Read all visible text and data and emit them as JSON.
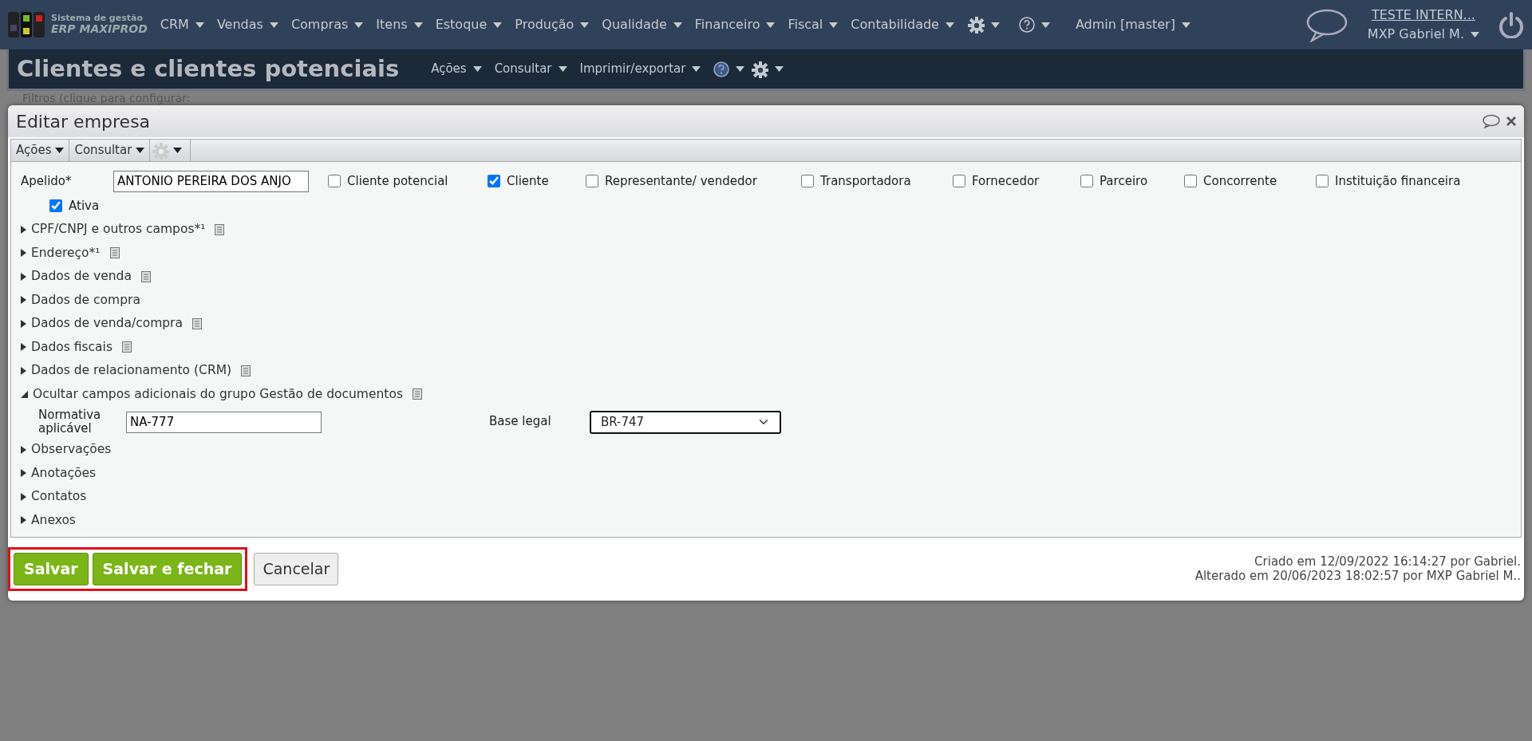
{
  "top_nav": {
    "logo": {
      "line1": "Sistema de gestão",
      "line2": "ERP MAXIPROD"
    },
    "menus": [
      {
        "label": "CRM"
      },
      {
        "label": "Vendas"
      },
      {
        "label": "Compras"
      },
      {
        "label": "Itens"
      },
      {
        "label": "Estoque"
      },
      {
        "label": "Produção"
      },
      {
        "label": "Qualidade"
      },
      {
        "label": "Financeiro"
      },
      {
        "label": "Fiscal"
      },
      {
        "label": "Contabilidade"
      }
    ],
    "admin": "Admin [master]",
    "company": "TESTE INTERN...",
    "user": "MXP Gabriel M."
  },
  "page_header": {
    "title": "Clientes e clientes potenciais",
    "menus": [
      "Ações",
      "Consultar",
      "Imprimir/exportar"
    ]
  },
  "filter_bar": {
    "text": "Filtros (clique para configurar:"
  },
  "dialog": {
    "title": "Editar empresa",
    "toolbar": [
      "Ações",
      "Consultar"
    ],
    "apelido": {
      "label": "Apelido*",
      "value": "ANTONIO PEREIRA DOS ANJO"
    },
    "roles": [
      {
        "label": "Cliente potencial",
        "checked": false
      },
      {
        "label": "Cliente",
        "checked": true
      },
      {
        "label": "Representante/ vendedor",
        "checked": false
      },
      {
        "label": "Transportadora",
        "checked": false
      },
      {
        "label": "Fornecedor",
        "checked": false
      },
      {
        "label": "Parceiro",
        "checked": false
      },
      {
        "label": "Concorrente",
        "checked": false
      },
      {
        "label": "Instituição financeira",
        "checked": false
      }
    ],
    "ativa": {
      "label": "Ativa",
      "checked": true
    },
    "sections": [
      {
        "label": "CPF/CNPJ e outros campos*¹",
        "expanded": false,
        "note": true
      },
      {
        "label": "Endereço*¹",
        "expanded": false,
        "note": true
      },
      {
        "label": "Dados de venda",
        "expanded": false,
        "note": true
      },
      {
        "label": "Dados de compra",
        "expanded": false,
        "note": false
      },
      {
        "label": "Dados de venda/compra",
        "expanded": false,
        "note": true
      },
      {
        "label": "Dados fiscais",
        "expanded": false,
        "note": true
      },
      {
        "label": "Dados de relacionamento (CRM)",
        "expanded": false,
        "note": true
      },
      {
        "label": "Ocultar campos adicionais do grupo Gestão de documentos",
        "expanded": true,
        "note": true,
        "fields": [
          {
            "kind": "input",
            "label": "Normativa aplicável",
            "value": "NA-777"
          },
          {
            "kind": "select",
            "label": "Base legal",
            "value": "BR-747"
          }
        ]
      },
      {
        "label": "Observações",
        "expanded": false,
        "note": false
      },
      {
        "label": "Anotações",
        "expanded": false,
        "note": false
      },
      {
        "label": "Contatos",
        "expanded": false,
        "note": false
      },
      {
        "label": "Anexos",
        "expanded": false,
        "note": false
      }
    ],
    "buttons": [
      {
        "label": "Salvar",
        "kind": "primary",
        "highlighted": true
      },
      {
        "label": "Salvar e fechar",
        "kind": "primary",
        "highlighted": true
      },
      {
        "label": "Cancelar",
        "kind": "secondary",
        "highlighted": false
      }
    ],
    "audit": [
      "Criado em 12/09/2022 16:14:27 por Gabriel.",
      "Alterado em 20/06/2023 18:02:57 por MXP Gabriel M.."
    ]
  }
}
